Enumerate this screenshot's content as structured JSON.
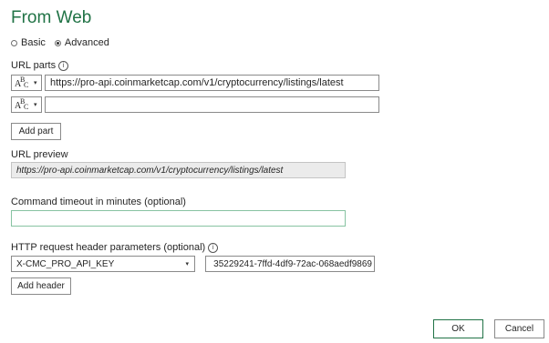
{
  "dialog": {
    "title": "From Web"
  },
  "mode": {
    "options": [
      {
        "label": "Basic",
        "selected": false
      },
      {
        "label": "Advanced",
        "selected": true
      }
    ]
  },
  "url_parts": {
    "label": "URL parts",
    "type_label": "ABC",
    "rows": [
      {
        "value": "https://pro-api.coinmarketcap.com/v1/cryptocurrency/listings/latest"
      },
      {
        "value": ""
      }
    ],
    "add_part_label": "Add part"
  },
  "url_preview": {
    "label": "URL preview",
    "value": "https://pro-api.coinmarketcap.com/v1/cryptocurrency/listings/latest"
  },
  "timeout": {
    "label": "Command timeout in minutes (optional)",
    "value": ""
  },
  "http_headers": {
    "label": "HTTP request header parameters (optional)",
    "selected_header": "X-CMC_PRO_API_KEY",
    "value": "35229241-7ffd-4df9-72ac-068aedf9869",
    "add_header_label": "Add header"
  },
  "footer": {
    "ok_label": "OK",
    "cancel_label": "Cancel"
  },
  "colors": {
    "accent": "#217346",
    "focus_border": "#87c3a2",
    "preview_bg": "#ebebeb"
  },
  "icons": {
    "info": "info-icon",
    "dropdown": "chevron-down-icon",
    "type": "abc-text-type-icon"
  }
}
